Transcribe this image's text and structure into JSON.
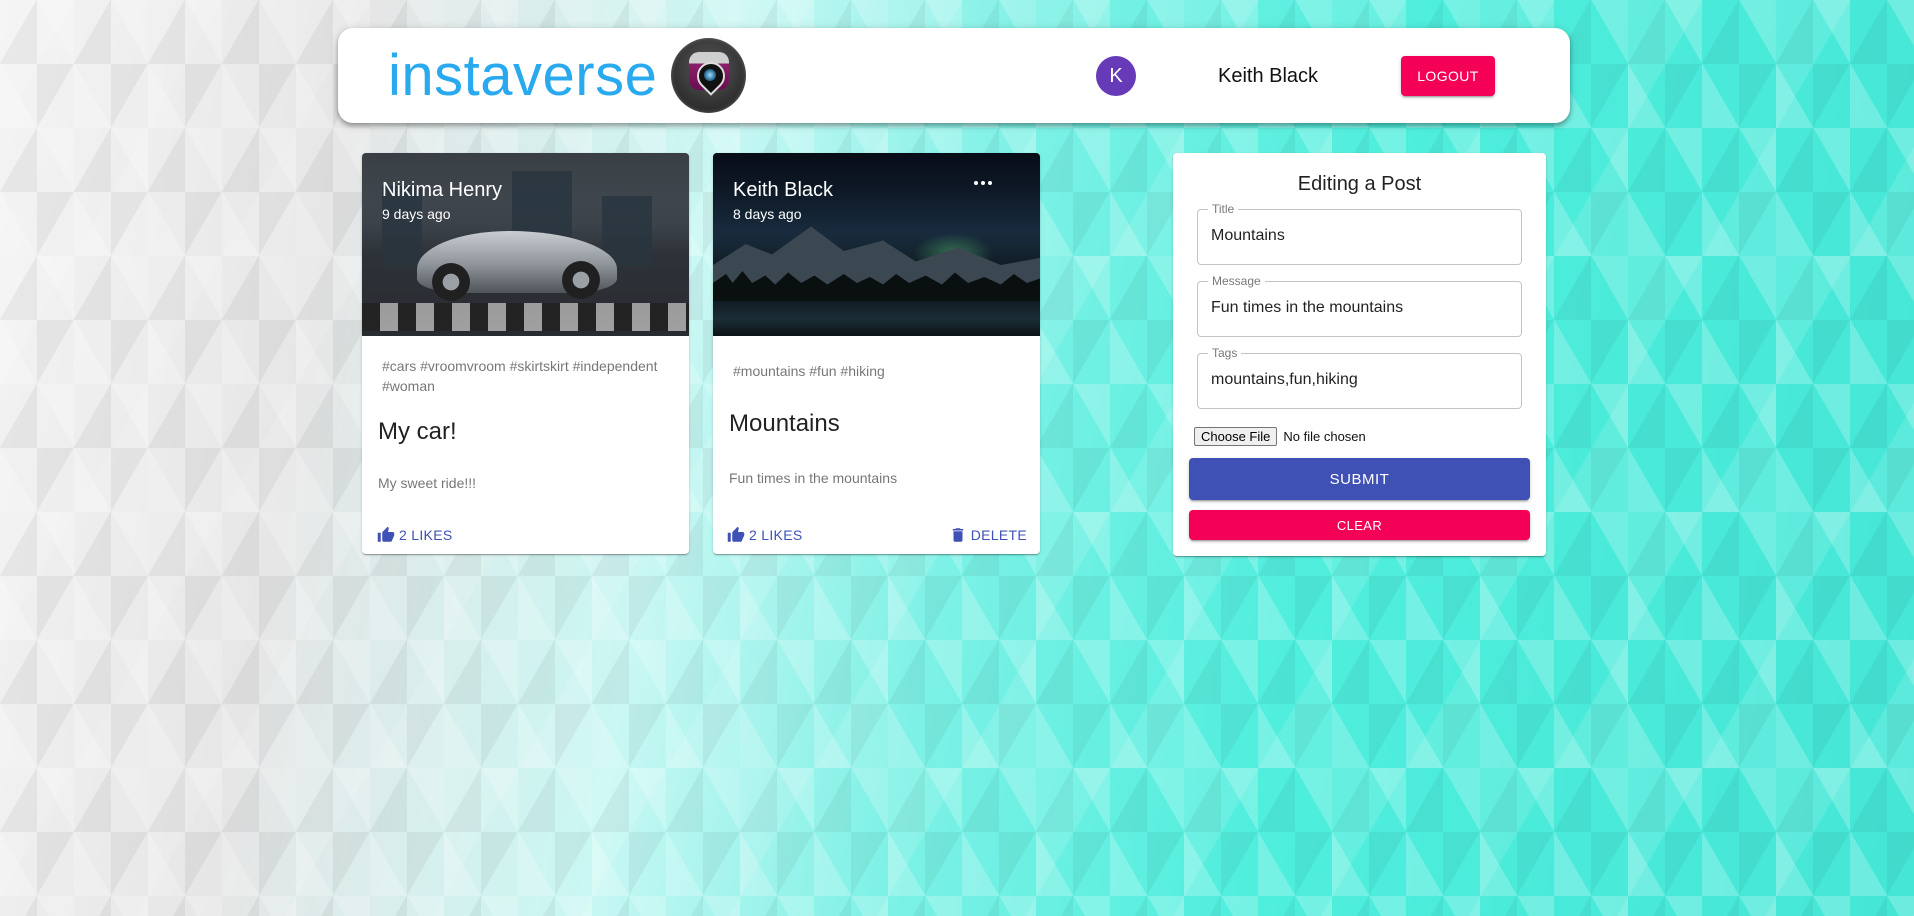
{
  "appbar": {
    "brand": "instaverse",
    "logo_icon": "camera-pin-logo-icon",
    "user": {
      "avatar_initial": "K",
      "avatar_color": "#673ab7",
      "name": "Keith Black"
    },
    "logout_label": "LOGOUT"
  },
  "colors": {
    "brand": "#29a9ee",
    "primary": "#3f51b5",
    "secondary": "#f50057"
  },
  "posts": [
    {
      "author": "Nikima Henry",
      "time": "9 days ago",
      "tags": "#cars #vroomvroom #skirtskirt #independent #woman",
      "title": "My car!",
      "message": "My sweet ride!!!",
      "likes_label": "2 LIKES",
      "image": "sports-car-photo"
    },
    {
      "author": "Keith Black",
      "time": "8 days ago",
      "tags": "#mountains #fun #hiking",
      "title": "Mountains",
      "message": "Fun times in the mountains",
      "likes_label": "2 LIKES",
      "delete_label": "DELETE",
      "more_icon": "more-horiz-icon",
      "image": "night-mountain-lake-photo"
    }
  ],
  "form": {
    "heading": "Editing a Post",
    "fields": {
      "title": {
        "label": "Title",
        "value": "Mountains"
      },
      "message": {
        "label": "Message",
        "value": "Fun times in the mountains"
      },
      "tags": {
        "label": "Tags",
        "value": "mountains,fun,hiking"
      }
    },
    "file": {
      "button_label": "Choose File",
      "status": "No file chosen"
    },
    "submit_label": "SUBMIT",
    "clear_label": "CLEAR"
  }
}
